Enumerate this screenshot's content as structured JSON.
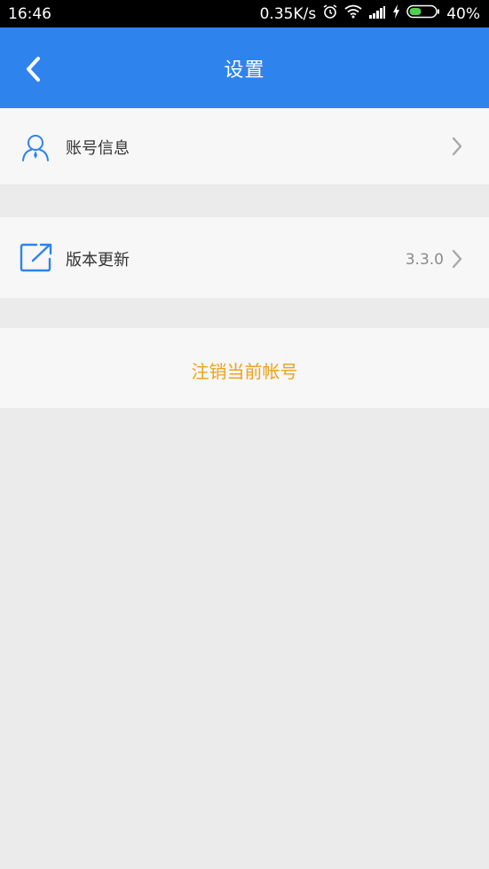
{
  "status_bar": {
    "time": "16:46",
    "speed": "0.35K/s",
    "battery": "40%",
    "icons": [
      "alarm-icon",
      "wifi-icon",
      "signal-icon",
      "charging-icon",
      "battery-icon"
    ]
  },
  "header": {
    "title": "设置",
    "back_icon": "chevron-left-icon",
    "background": "#2f83ec"
  },
  "settings": {
    "account_info": {
      "label": "账号信息",
      "icon": "user-icon"
    },
    "version_update": {
      "label": "版本更新",
      "icon": "external-link-icon",
      "value": "3.3.0"
    },
    "logout": {
      "label": "注销当前帐号",
      "color": "#f0a21a"
    }
  }
}
